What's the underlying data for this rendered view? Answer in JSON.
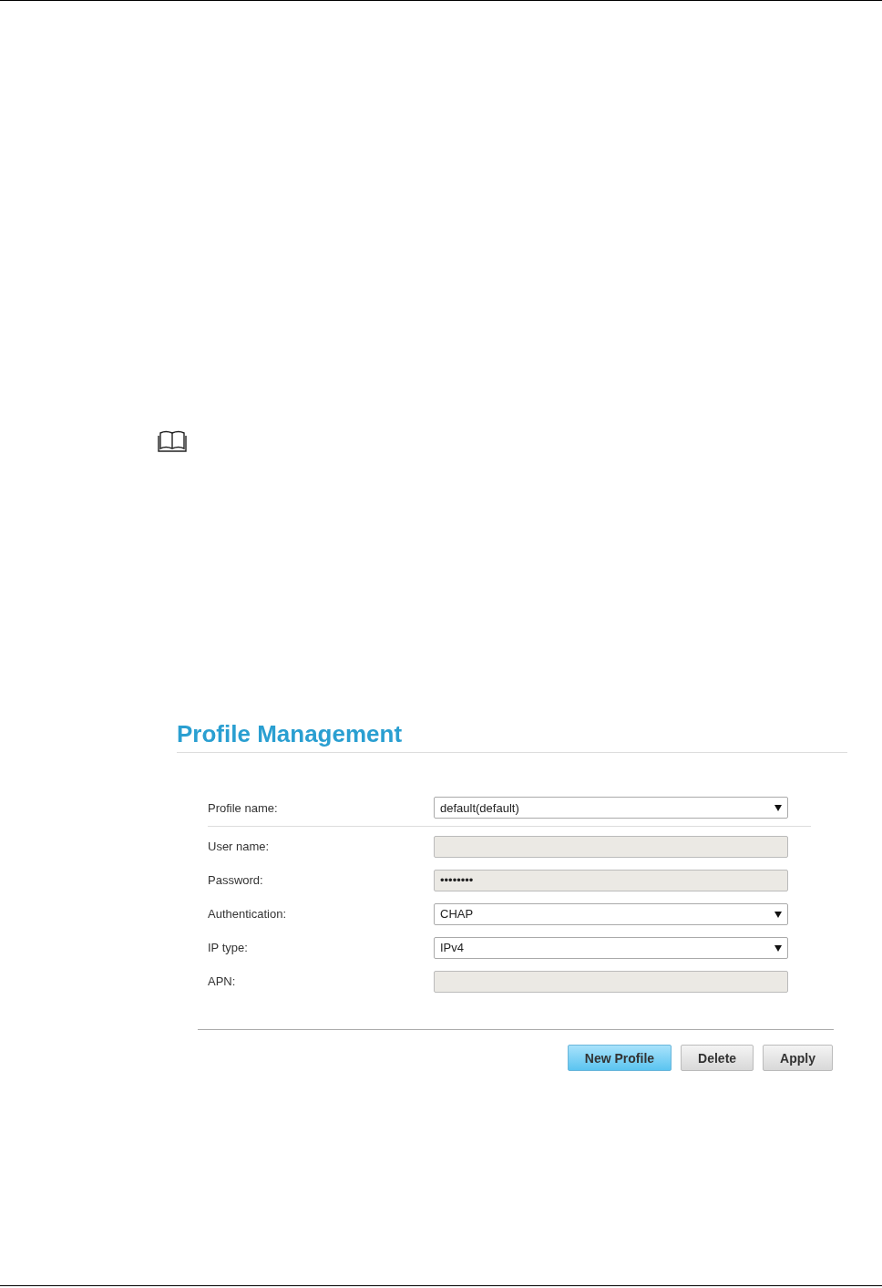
{
  "title": "Profile Management",
  "profile": {
    "label": "Profile name:",
    "kind": "select",
    "value": "default(default)",
    "disabled": false
  },
  "fields": [
    {
      "label": "User name:",
      "kind": "text",
      "disabled": true
    },
    {
      "label": "Password:",
      "kind": "text",
      "value": "••••••••",
      "disabled": true
    },
    {
      "label": "Authentication:",
      "kind": "select",
      "value": "CHAP",
      "disabled": false
    },
    {
      "label": "IP type:",
      "kind": "select",
      "value": "IPv4",
      "disabled": false
    },
    {
      "label": "APN:",
      "kind": "text",
      "disabled": true
    }
  ],
  "buttons": [
    {
      "label": "New Profile",
      "primary": true
    },
    {
      "label": "Delete",
      "primary": false
    },
    {
      "label": "Apply",
      "primary": false
    }
  ]
}
